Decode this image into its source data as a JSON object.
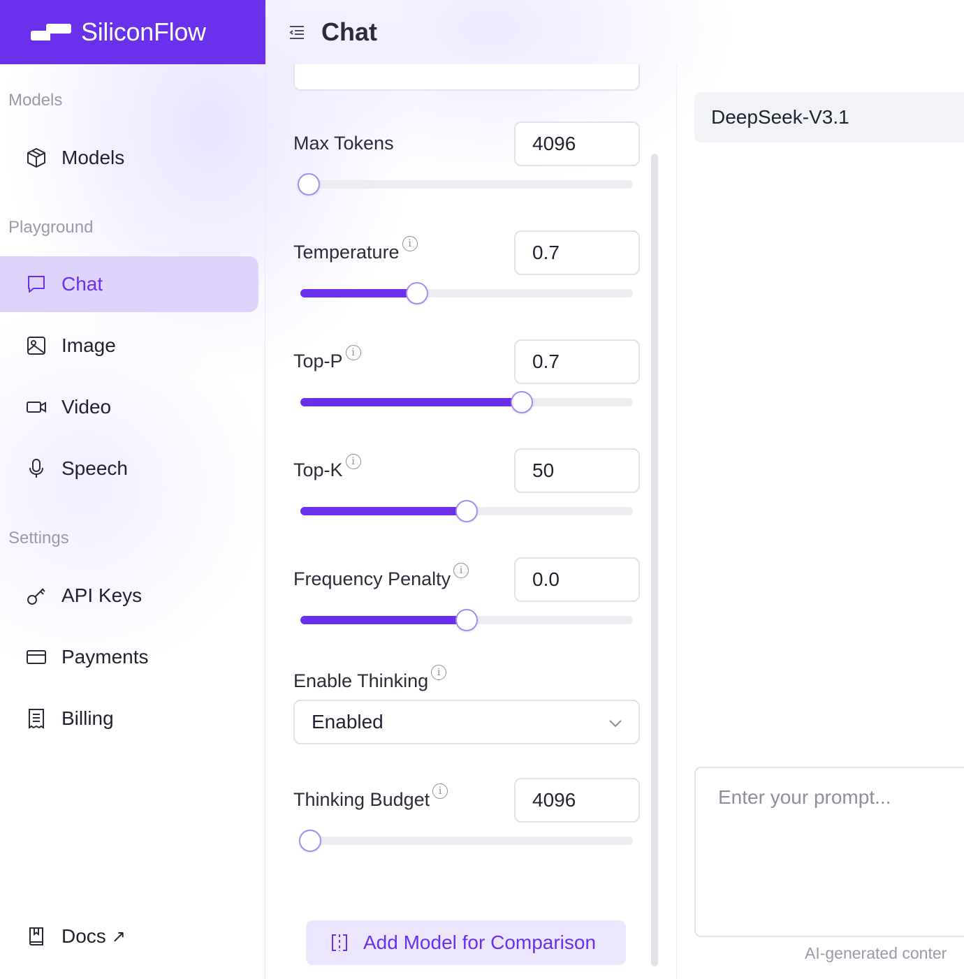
{
  "brand": {
    "name": "SiliconFlow"
  },
  "header": {
    "title": "Chat"
  },
  "sidebar": {
    "sections": [
      {
        "label": "Models"
      },
      {
        "label": "Playground"
      },
      {
        "label": "Settings"
      }
    ],
    "items": [
      {
        "label": "Models",
        "icon": "cube-icon"
      },
      {
        "label": "Chat",
        "icon": "chat-bubble-icon",
        "active": true
      },
      {
        "label": "Image",
        "icon": "image-icon"
      },
      {
        "label": "Video",
        "icon": "video-icon"
      },
      {
        "label": "Speech",
        "icon": "microphone-icon"
      },
      {
        "label": "API Keys",
        "icon": "key-icon"
      },
      {
        "label": "Payments",
        "icon": "credit-card-icon"
      },
      {
        "label": "Billing",
        "icon": "receipt-icon"
      },
      {
        "label": "Docs",
        "icon": "book-icon",
        "external_arrow": "↗"
      }
    ]
  },
  "params": {
    "max_tokens": {
      "label": "Max Tokens",
      "value": "4096",
      "slider_fraction": 0.025
    },
    "temperature": {
      "label": "Temperature",
      "value": "0.7",
      "slider_fraction": 0.35
    },
    "top_p": {
      "label": "Top-P",
      "value": "0.7",
      "slider_fraction": 0.666
    },
    "top_k": {
      "label": "Top-K",
      "value": "50",
      "slider_fraction": 0.5
    },
    "frequency_penalty": {
      "label": "Frequency Penalty",
      "value": "0.0",
      "slider_fraction": 0.5
    },
    "enable_thinking": {
      "label": "Enable Thinking",
      "selected": "Enabled"
    },
    "thinking_budget": {
      "label": "Thinking Budget",
      "value": "4096",
      "slider_fraction": 0.03
    },
    "info_glyph": "i"
  },
  "actions": {
    "add_model_label": "Add Model for Comparison"
  },
  "chat": {
    "model_name": "DeepSeek-V3.1",
    "prompt_placeholder": "Enter your prompt...",
    "footnote": "AI-generated conter"
  },
  "colors": {
    "accent": "#6a30ec",
    "active_bg": "#ddd3fb",
    "button_bg": "#ece6fd"
  }
}
